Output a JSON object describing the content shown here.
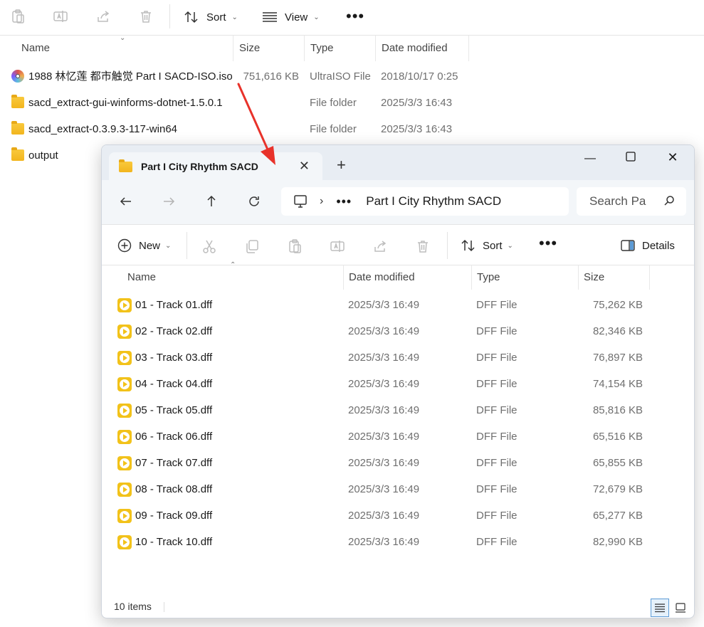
{
  "background": {
    "toolbar": {
      "sort_label": "Sort",
      "view_label": "View",
      "more": "•••"
    },
    "columns": [
      "Name",
      "Size",
      "Type",
      "Date modified"
    ],
    "rows": [
      {
        "name": "1988 林忆莲 都市触觉 Part I SACD-ISO.iso",
        "size": "751,616 KB",
        "type": "UltraISO File",
        "date": "2018/10/17 0:25",
        "icon": "disc-image-icon"
      },
      {
        "name": "sacd_extract-gui-winforms-dotnet-1.5.0.1",
        "size": "",
        "type": "File folder",
        "date": "2025/3/3 16:43",
        "icon": "folder-icon"
      },
      {
        "name": "sacd_extract-0.3.9.3-117-win64",
        "size": "",
        "type": "File folder",
        "date": "2025/3/3 16:43",
        "icon": "folder-icon"
      },
      {
        "name": "output",
        "size": "",
        "type": "",
        "date": "",
        "icon": "folder-icon"
      }
    ]
  },
  "window": {
    "tab_title": "Part I City Rhythm SACD",
    "address": {
      "more": "•••",
      "current": "Part I City Rhythm SACD"
    },
    "search_placeholder": "Search Part I City Rhythm SACD",
    "commands": {
      "new_label": "New",
      "sort_label": "Sort",
      "more": "•••",
      "details_label": "Details"
    },
    "columns": [
      "Name",
      "Date modified",
      "Type",
      "Size"
    ],
    "files": [
      {
        "name": "01 - Track 01.dff",
        "date": "2025/3/3 16:49",
        "type": "DFF File",
        "size": "75,262 KB"
      },
      {
        "name": "02 - Track 02.dff",
        "date": "2025/3/3 16:49",
        "type": "DFF File",
        "size": "82,346 KB"
      },
      {
        "name": "03 - Track 03.dff",
        "date": "2025/3/3 16:49",
        "type": "DFF File",
        "size": "76,897 KB"
      },
      {
        "name": "04 - Track 04.dff",
        "date": "2025/3/3 16:49",
        "type": "DFF File",
        "size": "74,154 KB"
      },
      {
        "name": "05 - Track 05.dff",
        "date": "2025/3/3 16:49",
        "type": "DFF File",
        "size": "85,816 KB"
      },
      {
        "name": "06 - Track 06.dff",
        "date": "2025/3/3 16:49",
        "type": "DFF File",
        "size": "65,516 KB"
      },
      {
        "name": "07 - Track 07.dff",
        "date": "2025/3/3 16:49",
        "type": "DFF File",
        "size": "65,855 KB"
      },
      {
        "name": "08 - Track 08.dff",
        "date": "2025/3/3 16:49",
        "type": "DFF File",
        "size": "72,679 KB"
      },
      {
        "name": "09 - Track 09.dff",
        "date": "2025/3/3 16:49",
        "type": "DFF File",
        "size": "65,277 KB"
      },
      {
        "name": "10 - Track 10.dff",
        "date": "2025/3/3 16:49",
        "type": "DFF File",
        "size": "82,990 KB"
      }
    ],
    "status": {
      "item_count": "10 items"
    }
  },
  "colors": {
    "annotation_arrow": "#e8322a",
    "folder": "#f2b51e",
    "dff_icon": "#f2c21a",
    "accent": "#5c9bd6"
  }
}
